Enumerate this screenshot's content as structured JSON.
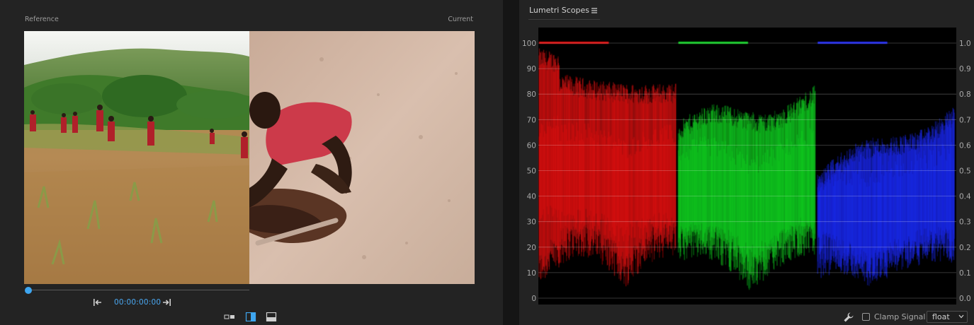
{
  "viewer": {
    "reference_label": "Reference",
    "current_label": "Current",
    "timecode": "00:00:00:00",
    "playhead_progress": 0
  },
  "icons": {
    "step_back": "step-back-icon",
    "step_forward": "step-forward-icon",
    "side_by_side": "side-by-side-icon",
    "vertical_split": "vertical-split-icon",
    "horizontal_split": "horizontal-split-icon",
    "panel_menu": "hamburger-menu-icon",
    "settings": "wrench-icon",
    "dropdown": "chevron-down-icon"
  },
  "scopes": {
    "title": "Lumetri Scopes",
    "clamp_signal_label": "Clamp Signal",
    "clamp_signal_checked": false,
    "bit_depth_value": "float",
    "left_axis": [
      "100",
      "90",
      "80",
      "70",
      "60",
      "50",
      "40",
      "30",
      "20",
      "10",
      "0"
    ],
    "right_axis": [
      "1.0",
      "0.9",
      "0.8",
      "0.7",
      "0.6",
      "0.5",
      "0.4",
      "0.3",
      "0.2",
      "0.1",
      "0.0"
    ]
  },
  "colors": {
    "accent": "#3ea6f0",
    "red_channel": "#e01010",
    "green_channel": "#10d020",
    "blue_channel": "#1a28f0"
  }
}
